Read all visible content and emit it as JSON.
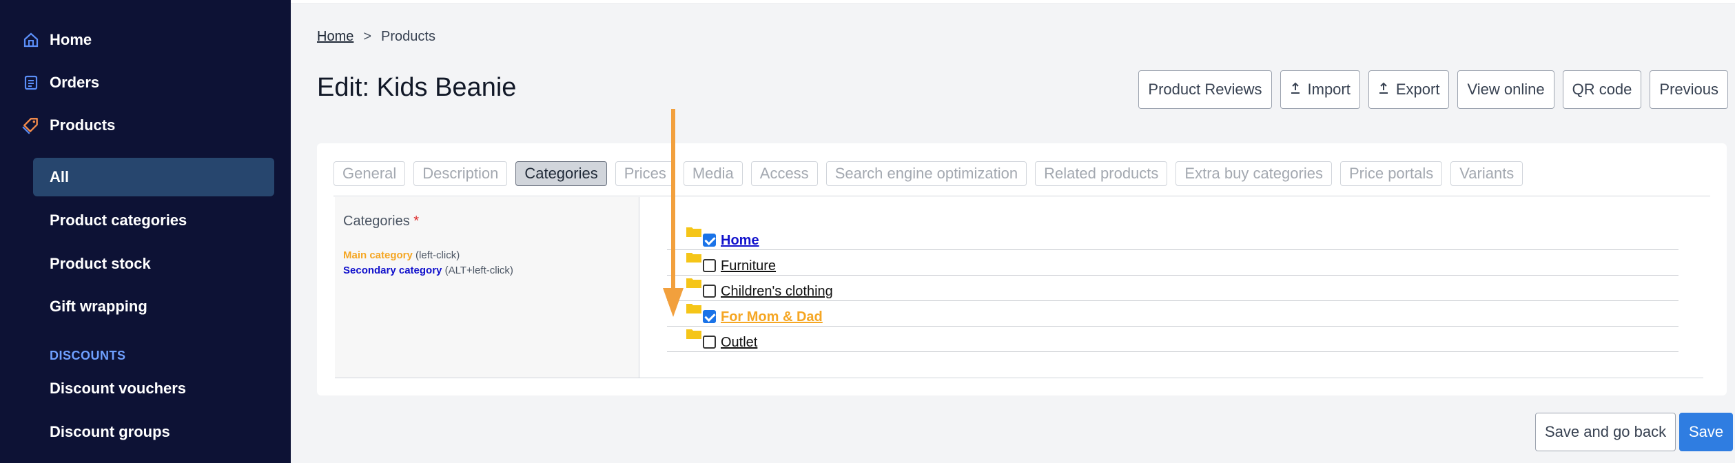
{
  "sidebar": {
    "items": [
      {
        "label": "Home",
        "icon": "home-icon"
      },
      {
        "label": "Orders",
        "icon": "orders-icon"
      },
      {
        "label": "Products",
        "icon": "tag-icon"
      }
    ],
    "sub_items": [
      {
        "label": "All",
        "active": true
      },
      {
        "label": "Product categories"
      },
      {
        "label": "Product stock"
      },
      {
        "label": "Gift wrapping"
      }
    ],
    "section_label": "DISCOUNTS",
    "discount_items": [
      {
        "label": "Discount vouchers"
      },
      {
        "label": "Discount groups"
      }
    ]
  },
  "breadcrumb": {
    "home": "Home",
    "separator": ">",
    "current": "Products"
  },
  "page_title": "Edit: Kids Beanie",
  "toolbar": {
    "product_reviews": "Product Reviews",
    "import": "Import",
    "export": "Export",
    "view_online": "View online",
    "qr_code": "QR code",
    "previous": "Previous"
  },
  "tabs": [
    "General",
    "Description",
    "Categories",
    "Prices",
    "Media",
    "Access",
    "Search engine optimization",
    "Related products",
    "Extra buy categories",
    "Price portals",
    "Variants"
  ],
  "active_tab": "Categories",
  "categories_panel": {
    "label": "Categories",
    "required_mark": "*",
    "legend_main": "Main category",
    "legend_main_hint": "(left-click)",
    "legend_secondary": "Secondary category",
    "legend_secondary_hint": "(ALT+left-click)"
  },
  "tree": [
    {
      "label": "Home",
      "checked": true,
      "role": "secondary"
    },
    {
      "label": "Furniture",
      "checked": false,
      "role": "none"
    },
    {
      "label": "Children's clothing",
      "checked": false,
      "role": "none"
    },
    {
      "label": "For Mom & Dad",
      "checked": true,
      "role": "main"
    },
    {
      "label": "Outlet",
      "checked": false,
      "role": "none"
    }
  ],
  "footer": {
    "save_and_go_back": "Save and go back",
    "save": "Save"
  },
  "colors": {
    "sidebar_bg": "#0d1235",
    "active_nav": "#27466e",
    "main_category": "#f5a623",
    "secondary_category": "#1111cc",
    "primary_button": "#2f7de1",
    "annotation_arrow": "#f2a03d"
  }
}
